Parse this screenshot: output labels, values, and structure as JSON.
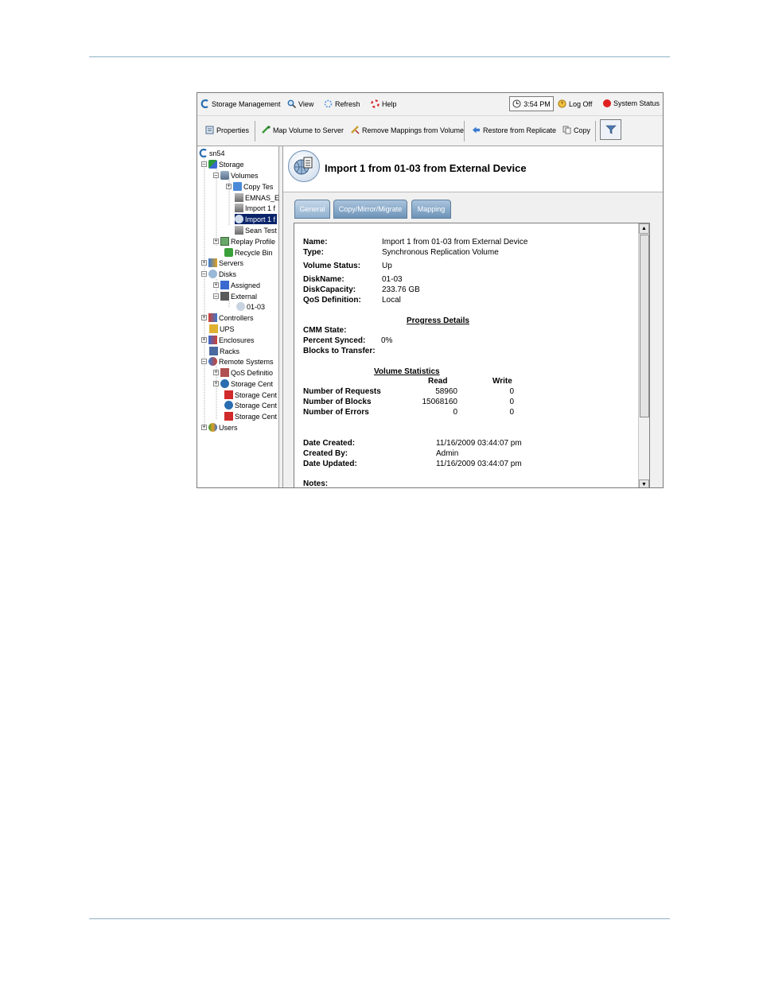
{
  "toolbar": {
    "storage_management": "Storage Management",
    "view": "View",
    "refresh": "Refresh",
    "help": "Help",
    "time": "3:54 PM",
    "log_off": "Log Off",
    "system_status": "System Status",
    "properties": "Properties",
    "map_volume": "Map Volume to Server",
    "remove_mappings": "Remove Mappings from Volume",
    "restore": "Restore from Replicate",
    "copy": "Copy"
  },
  "tree": {
    "root": "sn54",
    "storage": "Storage",
    "volumes": "Volumes",
    "copy_test": "Copy Tes",
    "emnas": "EMNAS_E",
    "import1": "Import 1 f",
    "import1_selected": "Import 1 f",
    "sean_test": "Sean Test",
    "replay_profiles": "Replay Profile",
    "recycle_bin": "Recycle Bin",
    "servers": "Servers",
    "disks": "Disks",
    "assigned": "Assigned",
    "external": "External",
    "disk_0103": "01-03",
    "controllers": "Controllers",
    "ups": "UPS",
    "enclosures": "Enclosures",
    "racks": "Racks",
    "remote_systems": "Remote Systems",
    "qos": "QoS Definitio",
    "sc1": "Storage Cent",
    "sc2": "Storage Cent",
    "sc3": "Storage Cent",
    "sc4": "Storage Cent",
    "users": "Users"
  },
  "panel": {
    "title": "Import 1  from 01-03 from External Device",
    "tabs": [
      "General",
      "Copy/Mirror/Migrate",
      "Mapping"
    ]
  },
  "details": {
    "name_label": "Name:",
    "name_value": "Import 1  from 01-03 from External Device",
    "type_label": "Type:",
    "type_value": "Synchronous Replication Volume",
    "status_label": "Volume Status:",
    "status_value": "Up",
    "diskname_label": "DiskName:",
    "diskname_value": "01-03",
    "capacity_label": "DiskCapacity:",
    "capacity_value": "233.76 GB",
    "qos_label": "QoS Definition:",
    "qos_value": "Local",
    "progress_heading": "Progress Details",
    "cmm_label": "CMM State:",
    "synced_label": "Percent Synced:",
    "synced_value": "0%",
    "blocks_transfer_label": "Blocks to Transfer:",
    "stats_heading": "Volume Statistics",
    "col_read": "Read",
    "col_write": "Write",
    "rows": [
      {
        "label": "Number of Requests",
        "read": "58960",
        "write": "0"
      },
      {
        "label": "Number of Blocks",
        "read": "15068160",
        "write": "0"
      },
      {
        "label": "Number of Errors",
        "read": "0",
        "write": "0"
      }
    ],
    "created_label": "Date Created:",
    "created_value": "11/16/2009 03:44:07 pm",
    "created_by_label": "Created By:",
    "created_by_value": "Admin",
    "updated_label": "Date Updated:",
    "updated_value": "11/16/2009 03:44:07 pm",
    "notes_label": "Notes:"
  },
  "colors": {
    "tab_blue": "#6d93b8",
    "selection": "#0a246a",
    "system_status_dot": "#e02020",
    "rule": "#8fb0c3"
  }
}
